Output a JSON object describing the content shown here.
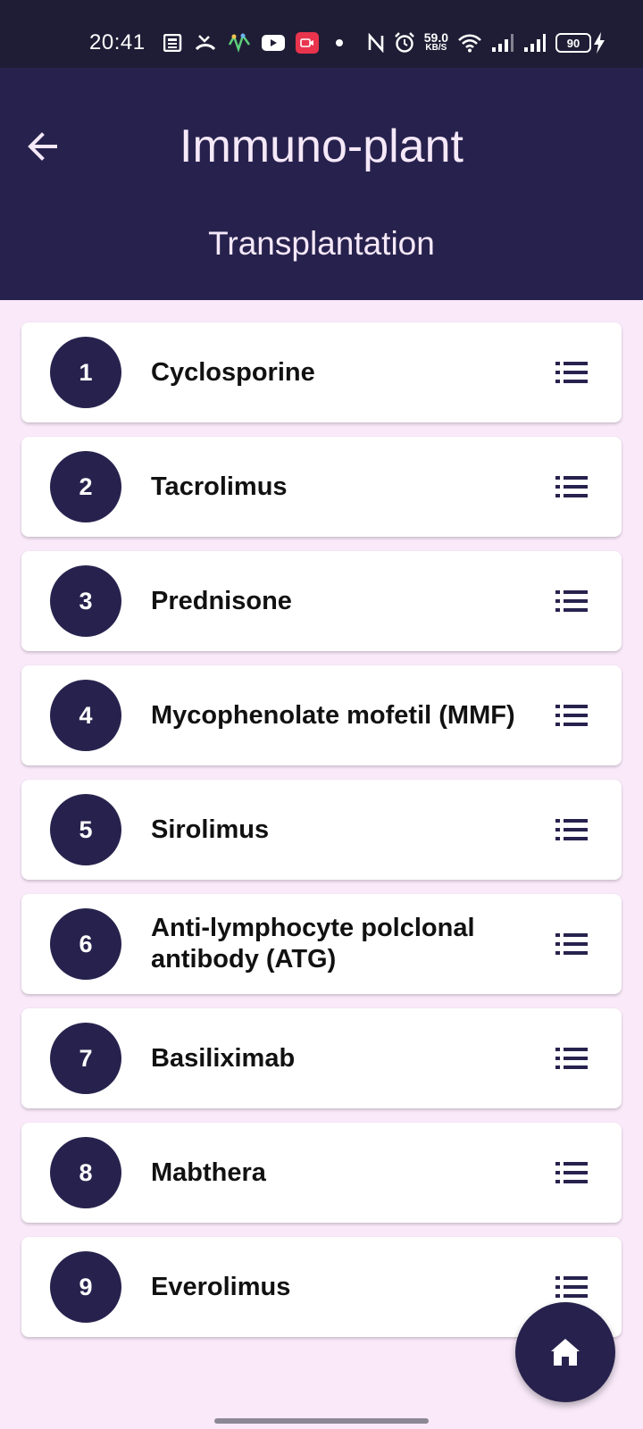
{
  "status_bar": {
    "time": "20:41",
    "net_speed_value": "59.0",
    "net_speed_unit": "KB/S",
    "battery_level": "90"
  },
  "app_bar": {
    "title": "Immuno-plant",
    "subtitle": "Transplantation"
  },
  "drugs": [
    {
      "number": "1",
      "name": "Cyclosporine"
    },
    {
      "number": "2",
      "name": "Tacrolimus"
    },
    {
      "number": "3",
      "name": "Prednisone"
    },
    {
      "number": "4",
      "name": "Mycophenolate mofetil (MMF)"
    },
    {
      "number": "5",
      "name": "Sirolimus"
    },
    {
      "number": "6",
      "name": "Anti-lymphocyte polclonal antibody (ATG)"
    },
    {
      "number": "7",
      "name": "Basiliximab"
    },
    {
      "number": "8",
      "name": "Mabthera"
    },
    {
      "number": "9",
      "name": "Everolimus"
    }
  ],
  "icons": {
    "back": "arrow-left-icon",
    "row_action": "list-icon",
    "fab": "home-icon"
  },
  "colors": {
    "primary": "#27224d",
    "background": "#f9e9f9",
    "card": "#ffffff",
    "on_primary": "#f5e8f8"
  }
}
